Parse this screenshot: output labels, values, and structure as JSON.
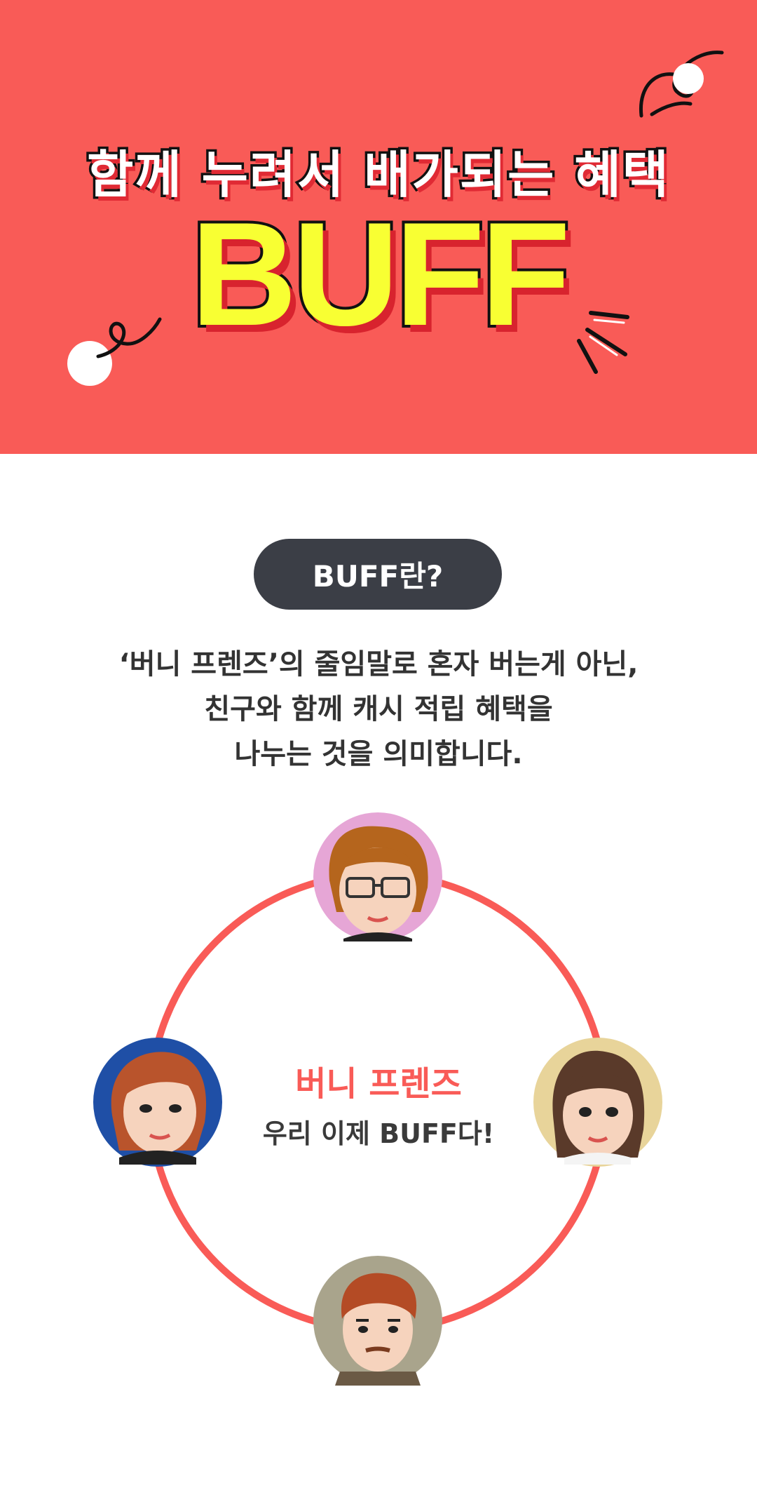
{
  "hero": {
    "subtitle": "함께 누려서 배가되는 혜택",
    "title": "BUFF"
  },
  "intro": {
    "badge_label": "BUFF란?",
    "description_lines": [
      "‘버니 프렌즈’의 줄임말로 혼자 버는게 아닌,",
      "친구와 함께 캐시 적립 혜택을",
      "나누는 것을 의미합니다."
    ]
  },
  "friends": {
    "title": "버니 프렌즈",
    "subtitle": "우리 이제 BUFF다!",
    "avatars": [
      {
        "name": "avatar-top",
        "bg": "#e6a6d6"
      },
      {
        "name": "avatar-left",
        "bg": "#1f4fa6"
      },
      {
        "name": "avatar-right",
        "bg": "#e8d49a"
      },
      {
        "name": "avatar-bottom",
        "bg": "#a9a48c"
      }
    ]
  },
  "colors": {
    "hero_bg": "#f95b57",
    "title_yellow": "#f8ff33",
    "badge_bg": "#3b3e46",
    "accent": "#f95b57"
  }
}
